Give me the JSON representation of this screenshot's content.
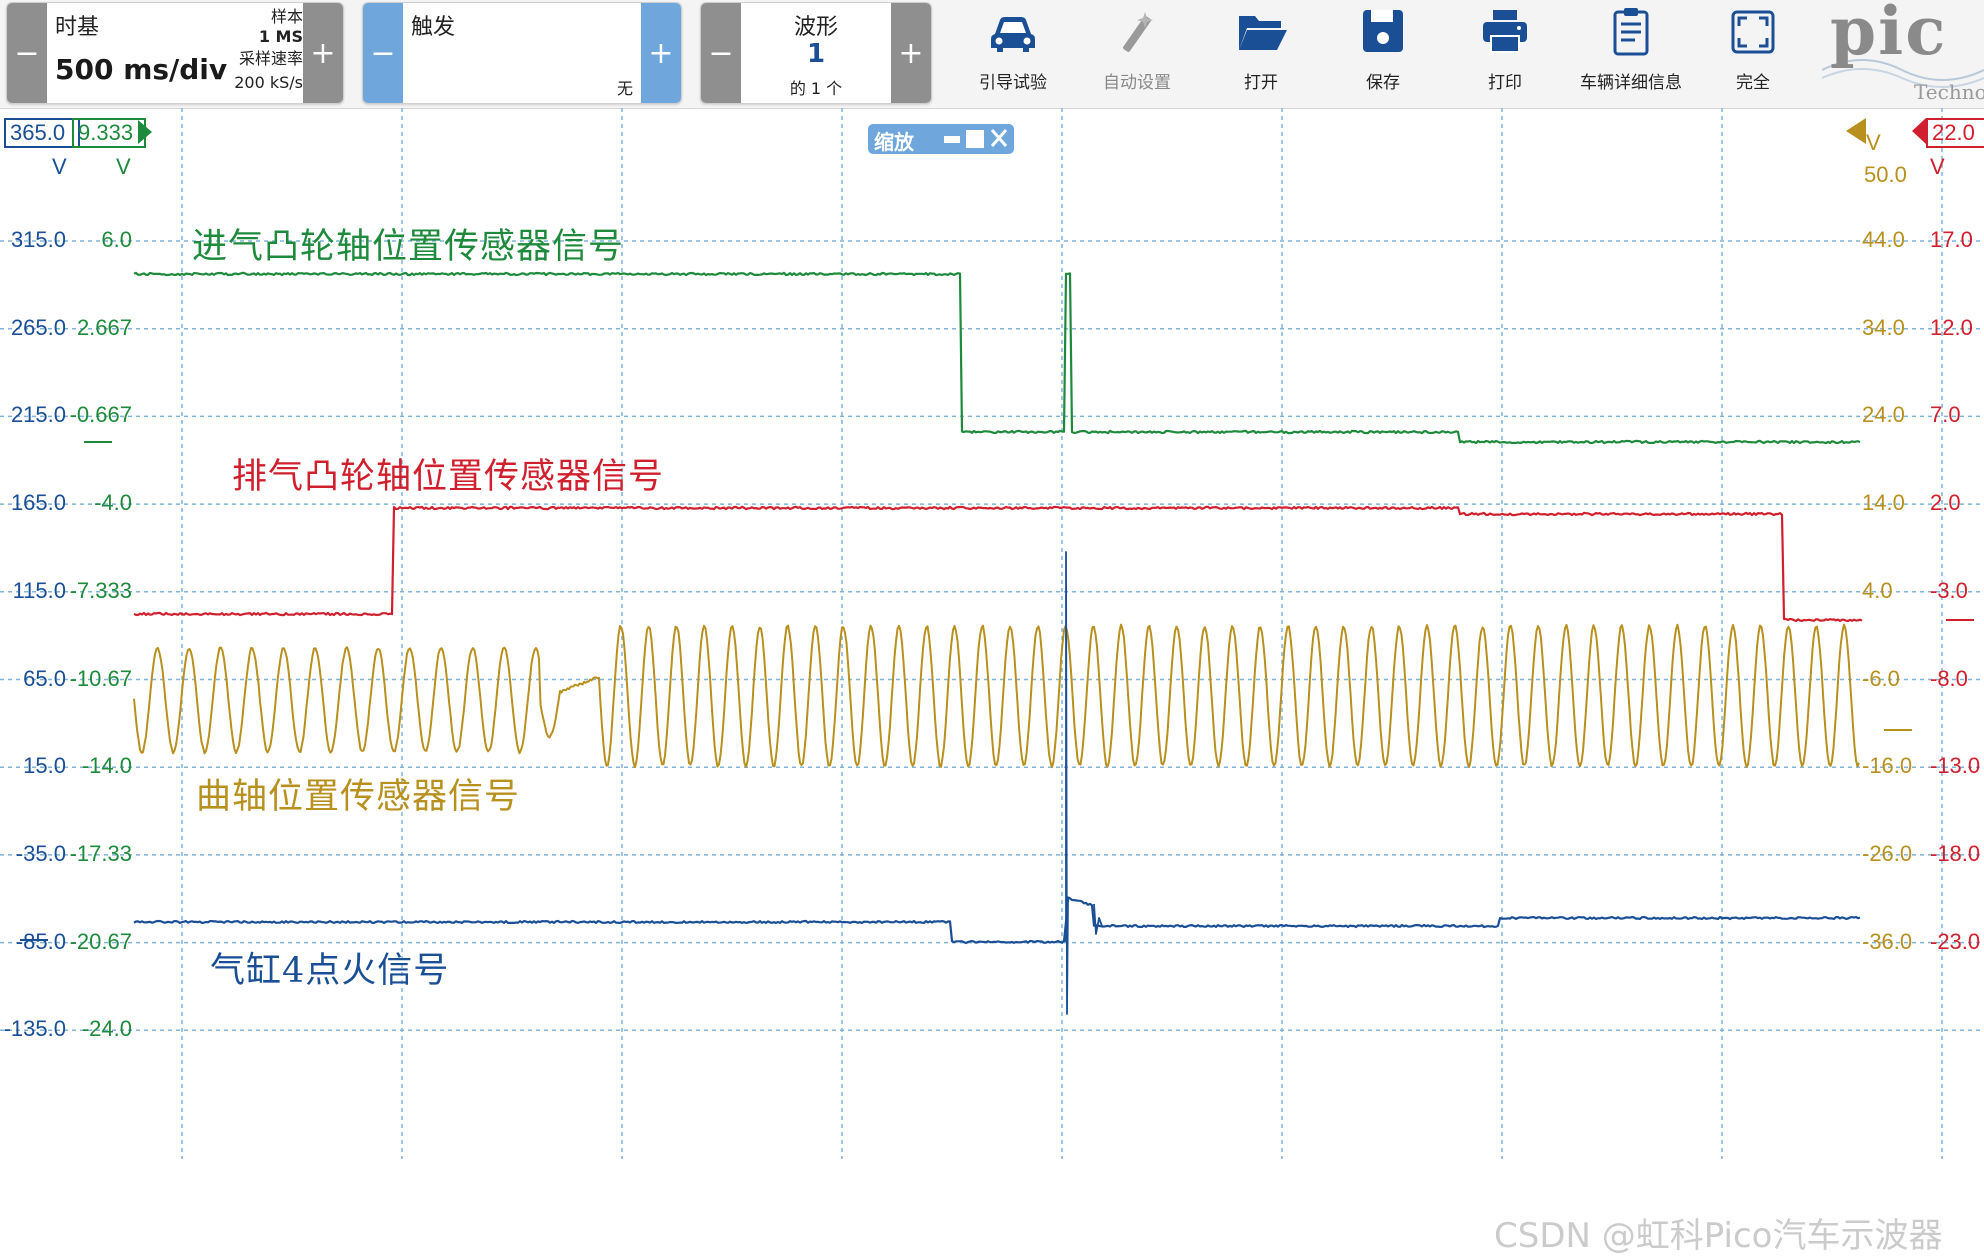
{
  "toolbar": {
    "timebase": {
      "title": "时基",
      "value": "500 ms/div",
      "samples_label": "样本",
      "samples_value": "1 MS",
      "rate_label": "采样速率",
      "rate_value": "200 kS/s",
      "minus": "−",
      "plus": "+"
    },
    "trigger": {
      "title": "触发",
      "mode": "无",
      "minus": "−",
      "plus": "+"
    },
    "waveform": {
      "title": "波形",
      "index": "1",
      "of_total": "的 1 个",
      "minus": "−",
      "plus": "+"
    },
    "buttons": [
      {
        "label": "引导试验",
        "icon": "car-icon"
      },
      {
        "label": "自动设置",
        "icon": "magic-wand-icon"
      },
      {
        "label": "打开",
        "icon": "folder-open-icon"
      },
      {
        "label": "保存",
        "icon": "save-disk-icon"
      },
      {
        "label": "打印",
        "icon": "printer-icon"
      },
      {
        "label": "车辆详细信息",
        "icon": "clipboard-icon"
      },
      {
        "label": "完全",
        "icon": "fullscreen-icon"
      }
    ],
    "logo": {
      "text": "pic",
      "subtext": "Techno"
    }
  },
  "zoom": {
    "label": "缩放"
  },
  "colors": {
    "blue": "#1a4f96",
    "green": "#1e8a3c",
    "red": "#d0202e",
    "gold": "#b8901e",
    "grid": "#7fb4d8",
    "toolbar_blue": "#6fa7dc"
  },
  "axes": {
    "blue_range": "365.0",
    "blue_unit": "V",
    "green_range": "9.333",
    "green_unit": "V",
    "gold_range_unit": "V",
    "gold_top": "50.0",
    "red_range": "22.0",
    "red_unit": "V",
    "rows": [
      {
        "blue": "315.0",
        "green": "6.0",
        "gold": "44.0",
        "red": "17.0"
      },
      {
        "blue": "265.0",
        "green": "2.667",
        "gold": "34.0",
        "red": "12.0"
      },
      {
        "blue": "215.0",
        "green": "-0.667",
        "gold": "24.0",
        "red": "7.0"
      },
      {
        "blue": "165.0",
        "green": "-4.0",
        "gold": "14.0",
        "red": "2.0"
      },
      {
        "blue": "115.0",
        "green": "-7.333",
        "gold": "4.0",
        "red": "-3.0"
      },
      {
        "blue": "65.0",
        "green": "-10.67",
        "gold": "-6.0",
        "red": "-8.0"
      },
      {
        "blue": "15.0",
        "green": "-14.0",
        "gold": "-16.0",
        "red": "-13.0"
      },
      {
        "blue": "-35.0",
        "green": "-17.33",
        "gold": "-26.0",
        "red": "-18.0"
      },
      {
        "blue": "-85.0",
        "green": "-20.67",
        "gold": "-36.0",
        "red": "-23.0"
      },
      {
        "blue": "-135.0",
        "green": "-24.0",
        "gold": "",
        "red": ""
      }
    ]
  },
  "channels": [
    {
      "name": "进气凸轮轴位置传感器信号",
      "color": "#1e8a3c"
    },
    {
      "name": "排气凸轮轴位置传感器信号",
      "color": "#d0202e"
    },
    {
      "name": "曲轴位置传感器信号",
      "color": "#b8901e"
    },
    {
      "name": "气缸4点火信号",
      "color": "#1a4f96"
    }
  ],
  "watermark": "CSDN @虹科Pico汽车示波器"
}
